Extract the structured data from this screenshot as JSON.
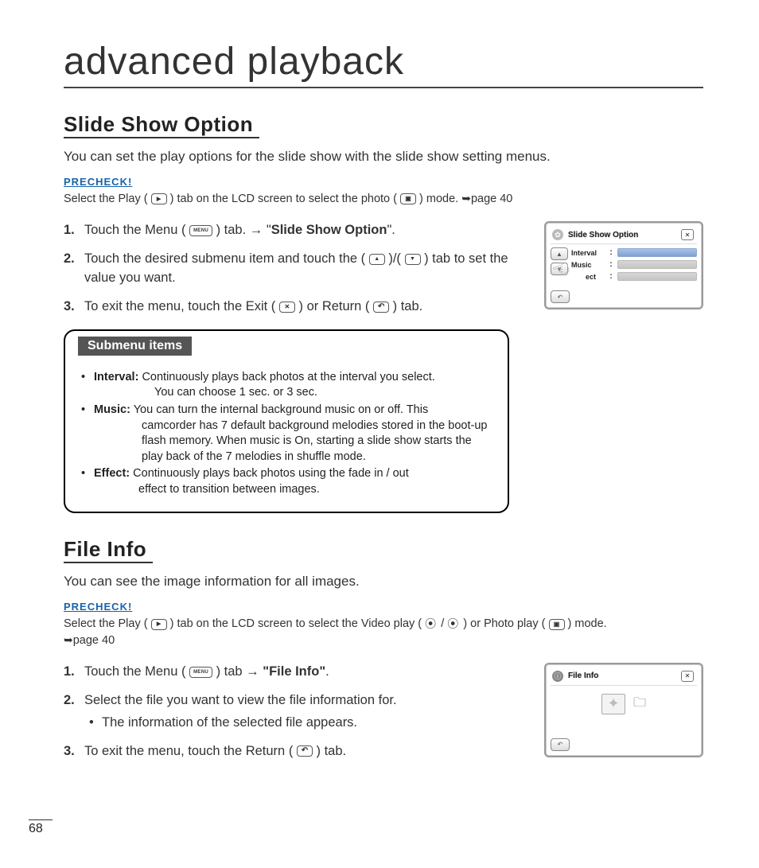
{
  "page_title": "advanced playback",
  "page_number": "68",
  "section1": {
    "heading": "Slide Show Option",
    "intro": "You can set the play options for the slide show with the slide show setting menus.",
    "precheck_label": "PRECHECK!",
    "precheck_pre": "Select the Play (",
    "precheck_mid": ") tab on the LCD screen to select the photo (",
    "precheck_post": ") mode. ",
    "precheck_pageref": "page 40",
    "step1_pre": "Touch the Menu (",
    "step1_mid": ") tab.  →  \"",
    "step1_bold": "Slide Show Option",
    "step1_post": "\".",
    "step2_pre": "Touch the desired submenu item and touch the (",
    "step2_mid": ")/(",
    "step2_post": ") tab to set the value you want.",
    "step3_pre": "To exit the menu, touch the Exit (",
    "step3_mid": ") or Return (",
    "step3_post": ") tab.",
    "submenu_title": "Submenu items",
    "submenu_items": [
      {
        "label": "Interval:",
        "text_first": "Continuously plays back photos at the interval you select.",
        "text_rest": "You can choose 1 sec. or 3 sec."
      },
      {
        "label": "Music:",
        "text_first": "You can turn the internal background music on or off. This",
        "text_rest": "camcorder has 7 default background melodies stored in the boot-up flash memory. When music is On, starting a slide show starts the play back of the 7 melodies in shuffle mode."
      },
      {
        "label": "Effect:",
        "text_first": "Continuously plays back photos using the fade in / out",
        "text_rest": "effect to transition between images."
      }
    ],
    "lcd": {
      "title": "Slide Show Option",
      "rows": [
        "Interval",
        "Music",
        "ect"
      ]
    }
  },
  "section2": {
    "heading": "File Info",
    "intro": "You can see the image information for all images.",
    "precheck_label": "PRECHECK!",
    "precheck_pre": "Select the Play (",
    "precheck_mid1": ") tab on the LCD screen to select the Video play (",
    "precheck_mid2": "/",
    "precheck_mid3": ") or Photo play (",
    "precheck_post": ") mode. ",
    "precheck_pageref": "page 40",
    "step1_pre": "Touch the Menu (",
    "step1_mid": ") tab  →  ",
    "step1_bold": "\"File Info\"",
    "step1_post": ".",
    "step2": "Select the file you want to view the file information for.",
    "step2_bullet": "The information of the selected file appears.",
    "step3_pre": "To exit the menu, touch the Return (",
    "step3_post": ") tab.",
    "lcd": {
      "title": "File Info"
    }
  }
}
